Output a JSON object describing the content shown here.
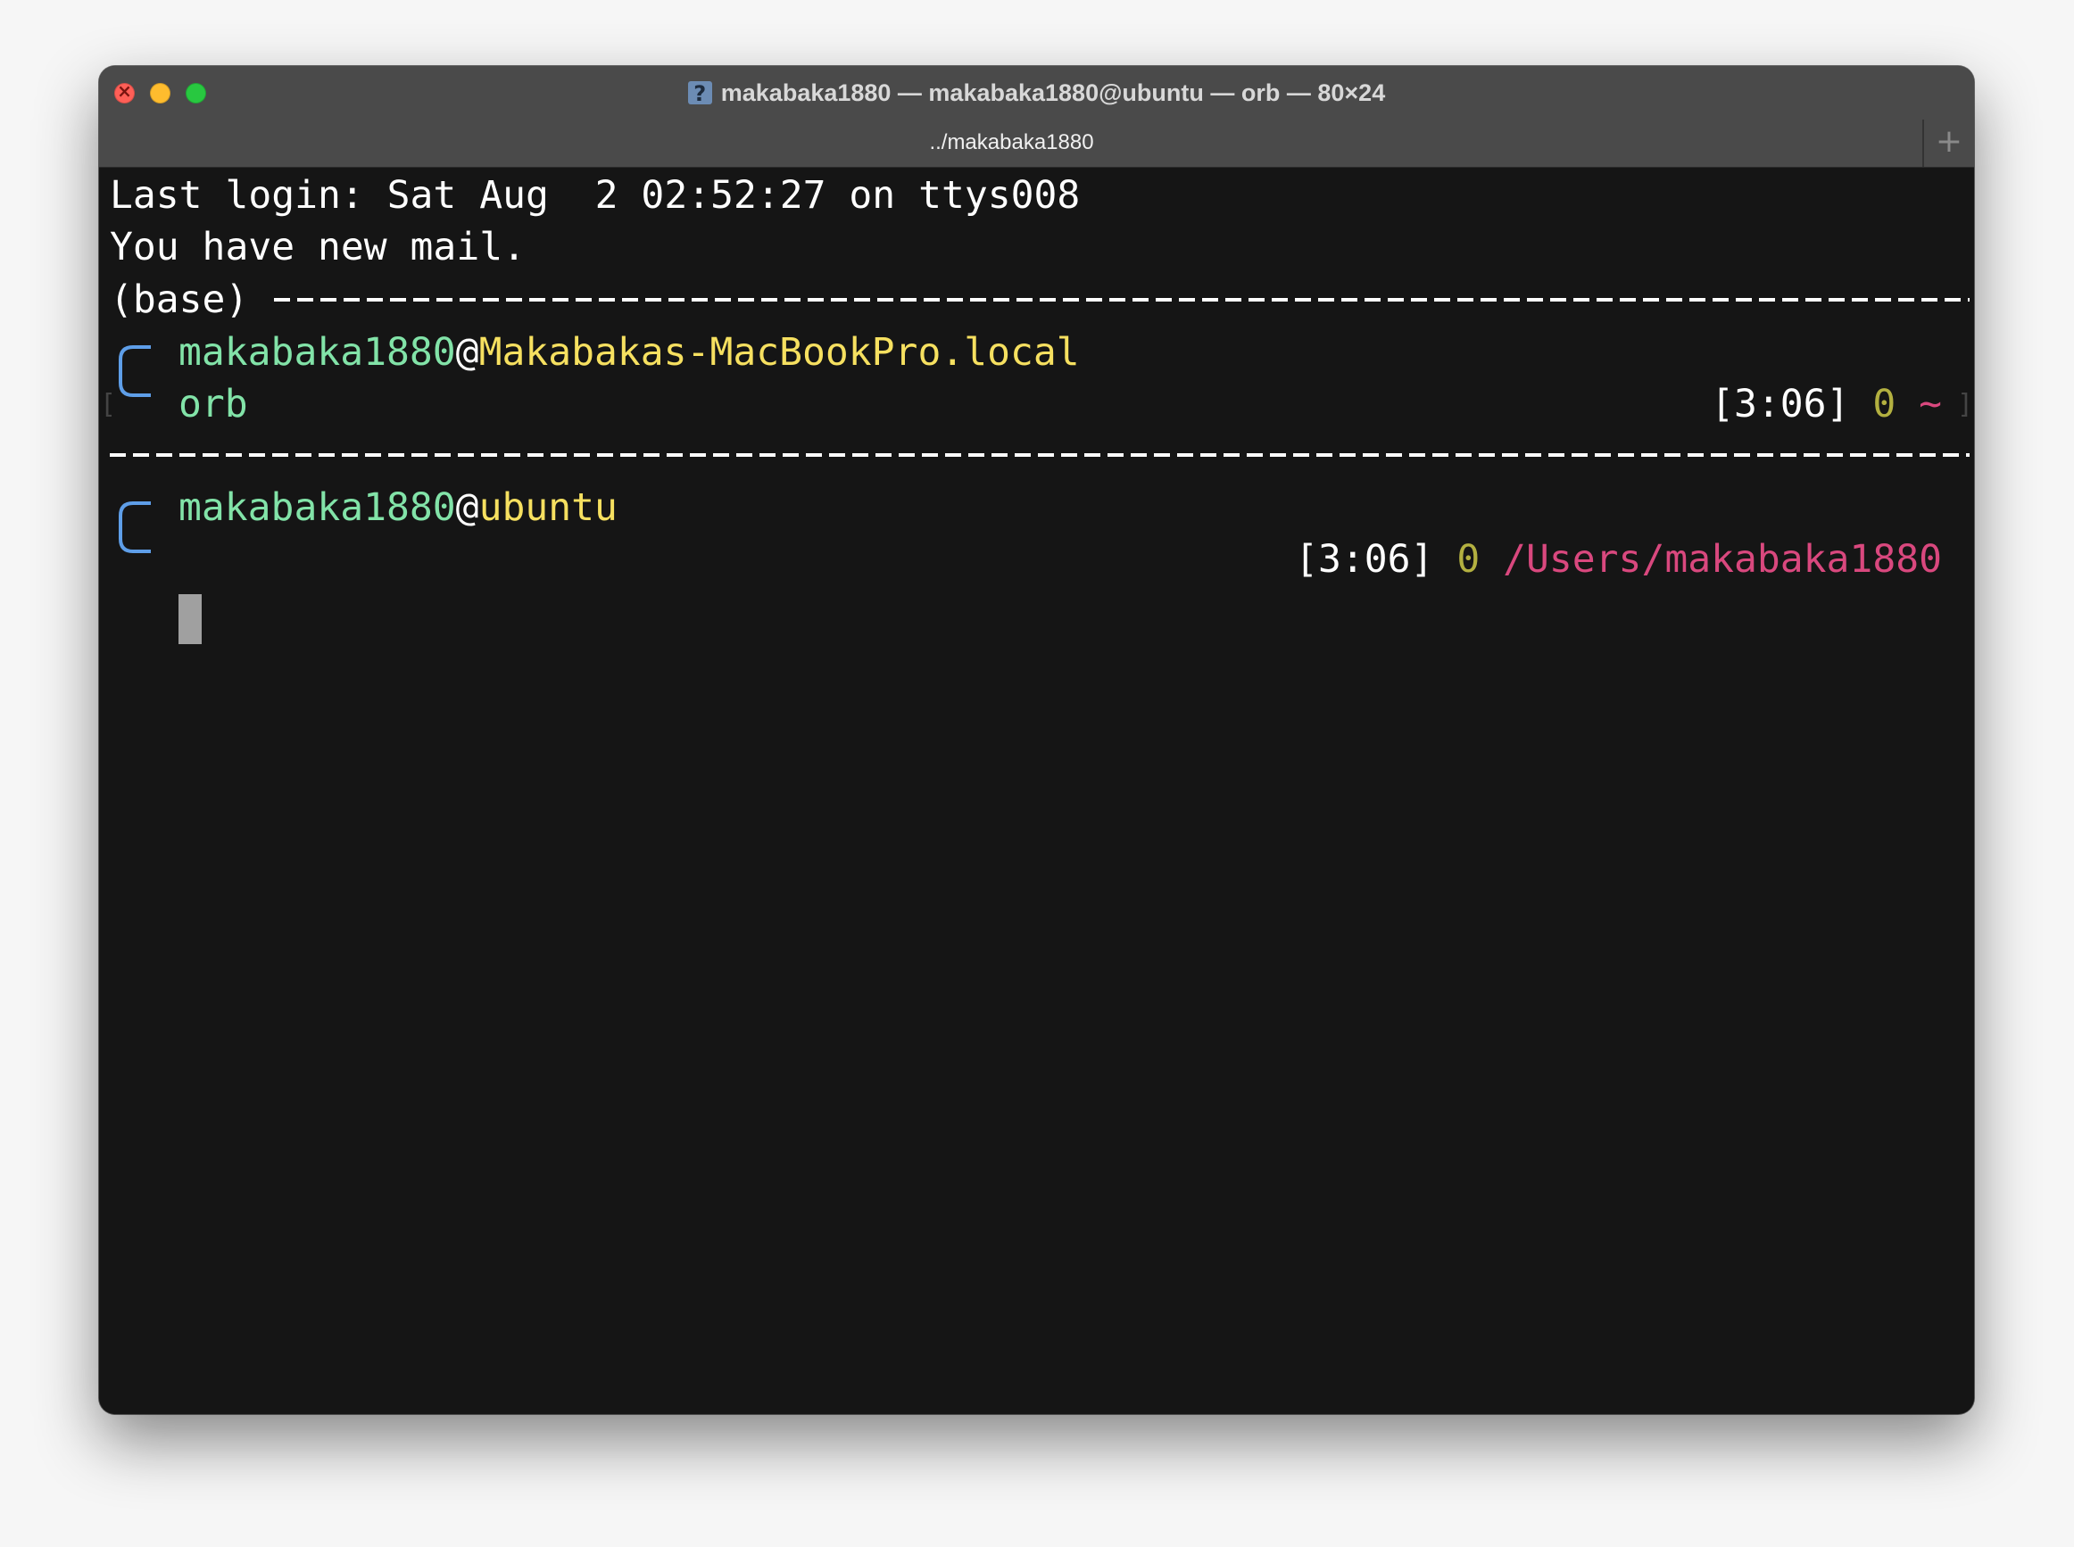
{
  "window": {
    "title": "makabaka1880 — makabaka1880@ubuntu — orb — 80×24",
    "tab_title": "../makabaka1880",
    "new_tab_symbol": "+"
  },
  "terminal": {
    "last_login": "Last login: Sat Aug  2 02:52:27 on ttys008",
    "mail_notice": "You have new mail.",
    "env_prefix": "(base)",
    "prompt1": {
      "user": "makabaka1880",
      "at": "@",
      "host": "Makabakas-MacBookPro.local",
      "command": "orb",
      "time": "[3:06]",
      "exit_code": "0",
      "dir": "~"
    },
    "prompt2": {
      "user": "makabaka1880",
      "at": "@",
      "host": "ubuntu",
      "time": "[3:06]",
      "exit_code": "0",
      "dir": "/Users/makabaka1880"
    }
  },
  "colors": {
    "user": "#82e3a8",
    "host": "#f6e060",
    "exit_code": "#b3b040",
    "dir": "#d9487e",
    "bracket": "#5e9ee8",
    "background": "#151515",
    "titlebar": "#4a4a4a"
  },
  "icons": {
    "title_icon": "terminal-help-icon",
    "prompt_bracket": "prompt-bracket-icon"
  }
}
